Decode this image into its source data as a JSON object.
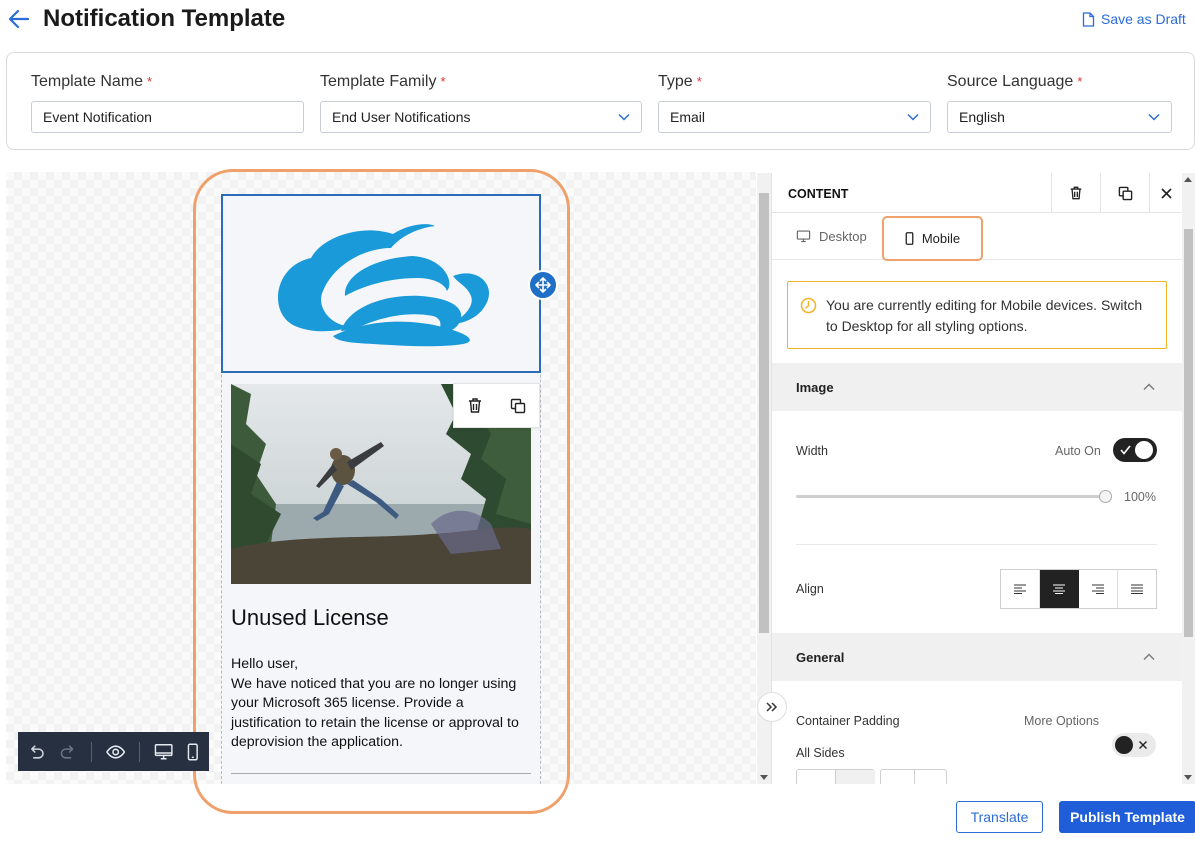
{
  "header": {
    "title": "Notification Template",
    "save_draft_label": "Save as Draft"
  },
  "form": {
    "template_name": {
      "label": "Template Name",
      "required": "*",
      "value": "Event Notification"
    },
    "template_family": {
      "label": "Template Family",
      "required": "*",
      "value": "End User Notifications"
    },
    "type": {
      "label": "Type",
      "required": "*",
      "value": "Email"
    },
    "source_language": {
      "label": "Source Language",
      "required": "*",
      "value": "English"
    }
  },
  "email_preview": {
    "heading": "Unused License",
    "greeting": "Hello user,",
    "body": "We have noticed that you are no longer using your Microsoft 365 license. Provide a justification to retain the license or approval to deprovision the application."
  },
  "panel": {
    "title": "CONTENT",
    "tabs": {
      "desktop": "Desktop",
      "mobile": "Mobile"
    },
    "notice": "You are currently editing for Mobile devices. Switch to Desktop for all styling options.",
    "image_section": {
      "title": "Image",
      "width_label": "Width",
      "auto_label": "Auto On",
      "width_value": "100%",
      "align_label": "Align"
    },
    "general_section": {
      "title": "General",
      "container_padding_label": "Container Padding",
      "more_options_label": "More Options",
      "all_sides_label": "All Sides"
    }
  },
  "footer": {
    "translate_label": "Translate",
    "publish_label": "Publish Template"
  },
  "colors": {
    "accent": "#1f5ed8",
    "brand_logo": "#1a9ad9",
    "highlight": "#f0a06a",
    "notice_border": "#f0b429"
  },
  "icons": [
    "back-arrow-icon",
    "document-icon",
    "chevron-down-icon",
    "move-icon",
    "trash-icon",
    "duplicate-icon",
    "undo-icon",
    "redo-icon",
    "eye-icon",
    "desktop-icon",
    "mobile-icon",
    "close-icon",
    "clock-icon",
    "chevron-up-icon",
    "align-left-icon",
    "align-center-icon",
    "align-right-icon",
    "align-justify-icon",
    "double-chevron-right-icon"
  ]
}
